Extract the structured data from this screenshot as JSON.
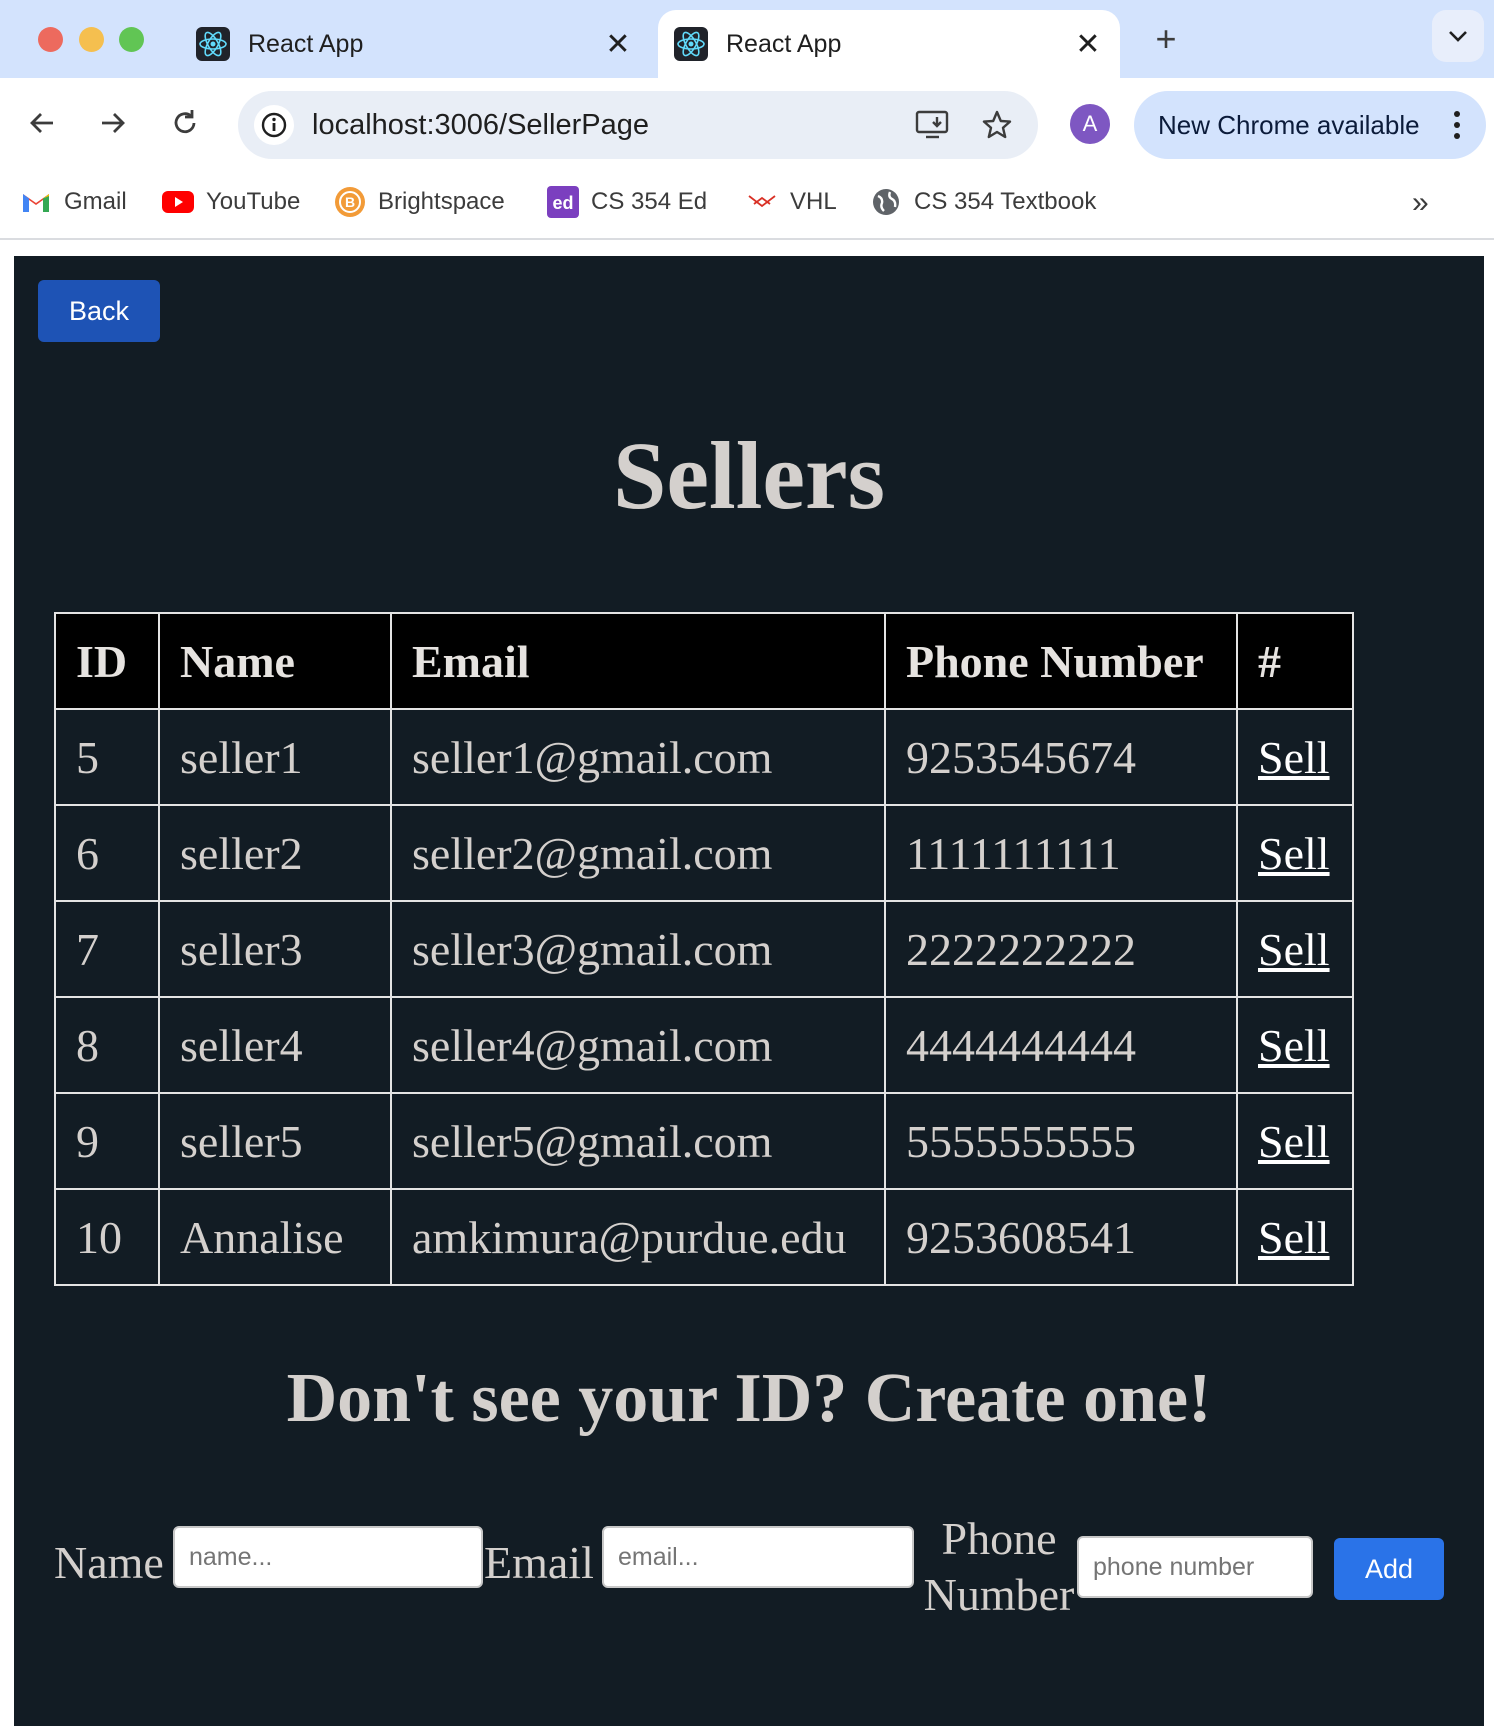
{
  "browser": {
    "tabs": [
      {
        "title": "React App",
        "active": false
      },
      {
        "title": "React App",
        "active": true
      }
    ],
    "url": "localhost:3006/SellerPage",
    "avatar_letter": "A",
    "update_label": "New Chrome available",
    "bookmarks": [
      {
        "label": "Gmail",
        "icon": "gmail-icon"
      },
      {
        "label": "YouTube",
        "icon": "youtube-icon"
      },
      {
        "label": "Brightspace",
        "icon": "brightspace-icon"
      },
      {
        "label": "CS 354 Ed",
        "icon": "ed-icon"
      },
      {
        "label": "VHL",
        "icon": "vhl-icon"
      },
      {
        "label": "CS 354 Textbook",
        "icon": "globe-icon"
      }
    ]
  },
  "page": {
    "back_label": "Back",
    "title": "Sellers",
    "table": {
      "headers": [
        "ID",
        "Name",
        "Email",
        "Phone Number",
        "#"
      ],
      "rows": [
        {
          "id": "5",
          "name": "seller1",
          "email": "seller1@gmail.com",
          "phone": "9253545674",
          "action": "Sell"
        },
        {
          "id": "6",
          "name": "seller2",
          "email": "seller2@gmail.com",
          "phone": "1111111111",
          "action": "Sell"
        },
        {
          "id": "7",
          "name": "seller3",
          "email": "seller3@gmail.com",
          "phone": "2222222222",
          "action": "Sell"
        },
        {
          "id": "8",
          "name": "seller4",
          "email": "seller4@gmail.com",
          "phone": "4444444444",
          "action": "Sell"
        },
        {
          "id": "9",
          "name": "seller5",
          "email": "seller5@gmail.com",
          "phone": "5555555555",
          "action": "Sell"
        },
        {
          "id": "10",
          "name": "Annalise",
          "email": "amkimura@purdue.edu",
          "phone": "9253608541",
          "action": "Sell"
        }
      ]
    },
    "create_heading": "Don't see your ID? Create one!",
    "form": {
      "name_label": "Name",
      "name_placeholder": "name...",
      "email_label": "Email",
      "email_placeholder": "email...",
      "phone_label_line1": "Phone",
      "phone_label_line2": "Number",
      "phone_placeholder": "phone number",
      "add_label": "Add"
    }
  },
  "colors": {
    "page_bg": "#121c24",
    "text": "#d4d0cd",
    "back_button": "#1e53b5",
    "add_button": "#2a73e8",
    "header_bg": "#000000"
  }
}
